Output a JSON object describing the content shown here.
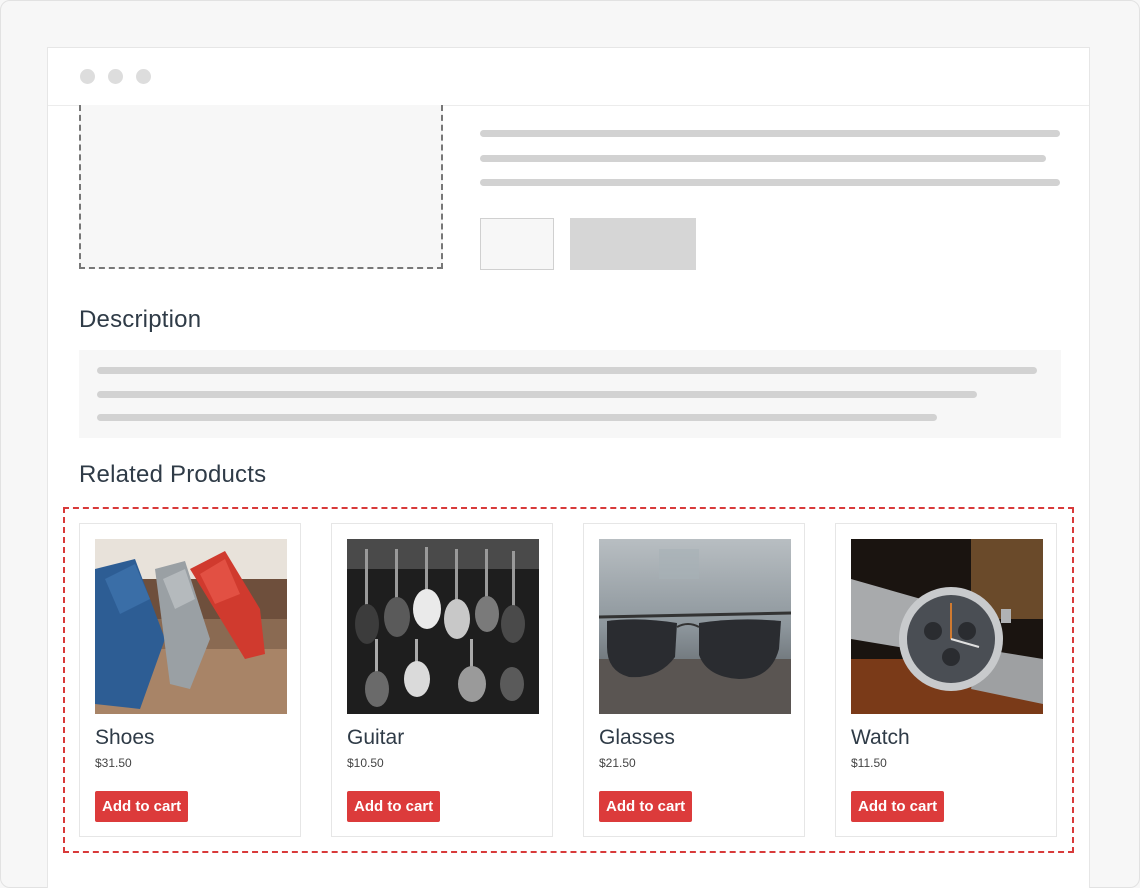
{
  "page": {
    "description_heading": "Description",
    "related_heading": "Related Products"
  },
  "products": [
    {
      "name": "Shoes",
      "price": "$31.50",
      "button": "Add to cart",
      "image_icon": "shoes-photo"
    },
    {
      "name": "Guitar",
      "price": "$10.50",
      "button": "Add to cart",
      "image_icon": "guitars-photo"
    },
    {
      "name": "Glasses",
      "price": "$21.50",
      "button": "Add to cart",
      "image_icon": "sunglasses-photo"
    },
    {
      "name": "Watch",
      "price": "$11.50",
      "button": "Add to cart",
      "image_icon": "watch-photo"
    }
  ],
  "colors": {
    "accent": "#dc3b3b",
    "placeholder": "#d2d2d2",
    "heading": "#2f3b47"
  }
}
